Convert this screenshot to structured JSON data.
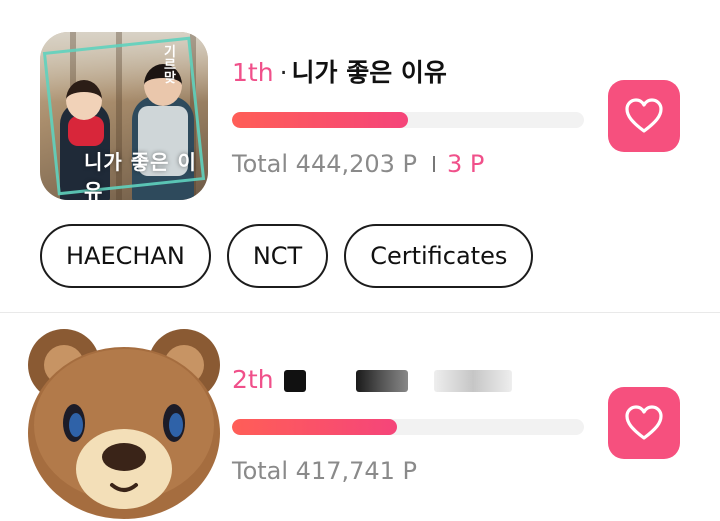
{
  "items": [
    {
      "rank": "1th",
      "title": "니가 좋은 이유",
      "progress": 0.5,
      "total_label": "Total 444,203 P",
      "my_points": "3 P",
      "cover_text": "니가 좋은 이유",
      "cover_corner_text": "기 르 맞",
      "tags": [
        "HAECHAN",
        "NCT",
        "Certificates"
      ]
    },
    {
      "rank": "2th",
      "progress": 0.47,
      "total_label": "Total 417,741 P",
      "avatar": "bear-emoji"
    }
  ],
  "colors": {
    "accent": "#f0508a",
    "heart_button": "#f6507e",
    "progress_start": "#ff5e57",
    "progress_end": "#f5457a"
  },
  "icons": {
    "vote": "heart-outline-icon"
  }
}
